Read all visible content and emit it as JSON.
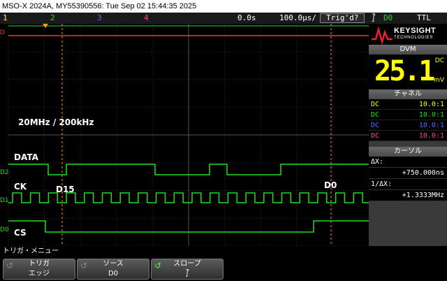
{
  "titlebar": {
    "text": "MSO-X 2024A, MY55390556: Tue Sep 02 15:44:35 2025"
  },
  "statusbar": {
    "ch1": "1",
    "ch2": "2",
    "ch3": "3",
    "ch4": "4",
    "delay": "0.0s",
    "timebase": "100.0μs/",
    "trig_state": "Trig'd?",
    "trig_slope": "⨛",
    "trig_source": "D0",
    "trig_level": "TTL",
    "colors": {
      "ch1": "#ffff00",
      "ch2": "#22dd22",
      "ch3": "#4d6bff",
      "ch4": "#ff4488"
    }
  },
  "screen": {
    "freq_label": "20MHz / 200kHz",
    "signals": [
      {
        "name": "DATA",
        "channel_tag": "D2"
      },
      {
        "name": "CK",
        "channel_tag": "D1"
      },
      {
        "name": "CS",
        "channel_tag": "D0"
      }
    ],
    "cursor_a_label": "D15",
    "cursor_b_label": "D0",
    "ref_tag": "D"
  },
  "panel": {
    "brand_name": "KEYSIGHT",
    "brand_sub": "TECHNOLOGIES",
    "dvm_title": "DVM",
    "dvm_value": "25.1",
    "dvm_mode": "DC",
    "dvm_unit": "mV",
    "channel_title": "チャネル",
    "channels": [
      {
        "coupling": "DC",
        "probe": "10.0:1",
        "color": "#ffff00"
      },
      {
        "coupling": "DC",
        "probe": "10.0:1",
        "color": "#22dd22"
      },
      {
        "coupling": "DC",
        "probe": "10.0:1",
        "color": "#4d6bff"
      },
      {
        "coupling": "DC",
        "probe": "10.0:1",
        "color": "#ff4488"
      }
    ],
    "cursor_title": "カーソル",
    "dx_label": "ΔX:",
    "dx_value": "+750.000ns",
    "inv_dx_label": "1/ΔX:",
    "inv_dx_value": "+1.3333MHz"
  },
  "menu": {
    "title": "トリガ・メニュー",
    "softkeys": [
      {
        "line1": "トリガ",
        "line2": "エッジ"
      },
      {
        "line1": "ソース",
        "line2": "D0"
      },
      {
        "line1": "スロープ",
        "line2": "⨛"
      }
    ]
  },
  "waveform_colors": {
    "digital_high": "#22dd22",
    "digital_low": "#33cccc",
    "ref": "#ff3333",
    "cursor": "#ff9922"
  }
}
